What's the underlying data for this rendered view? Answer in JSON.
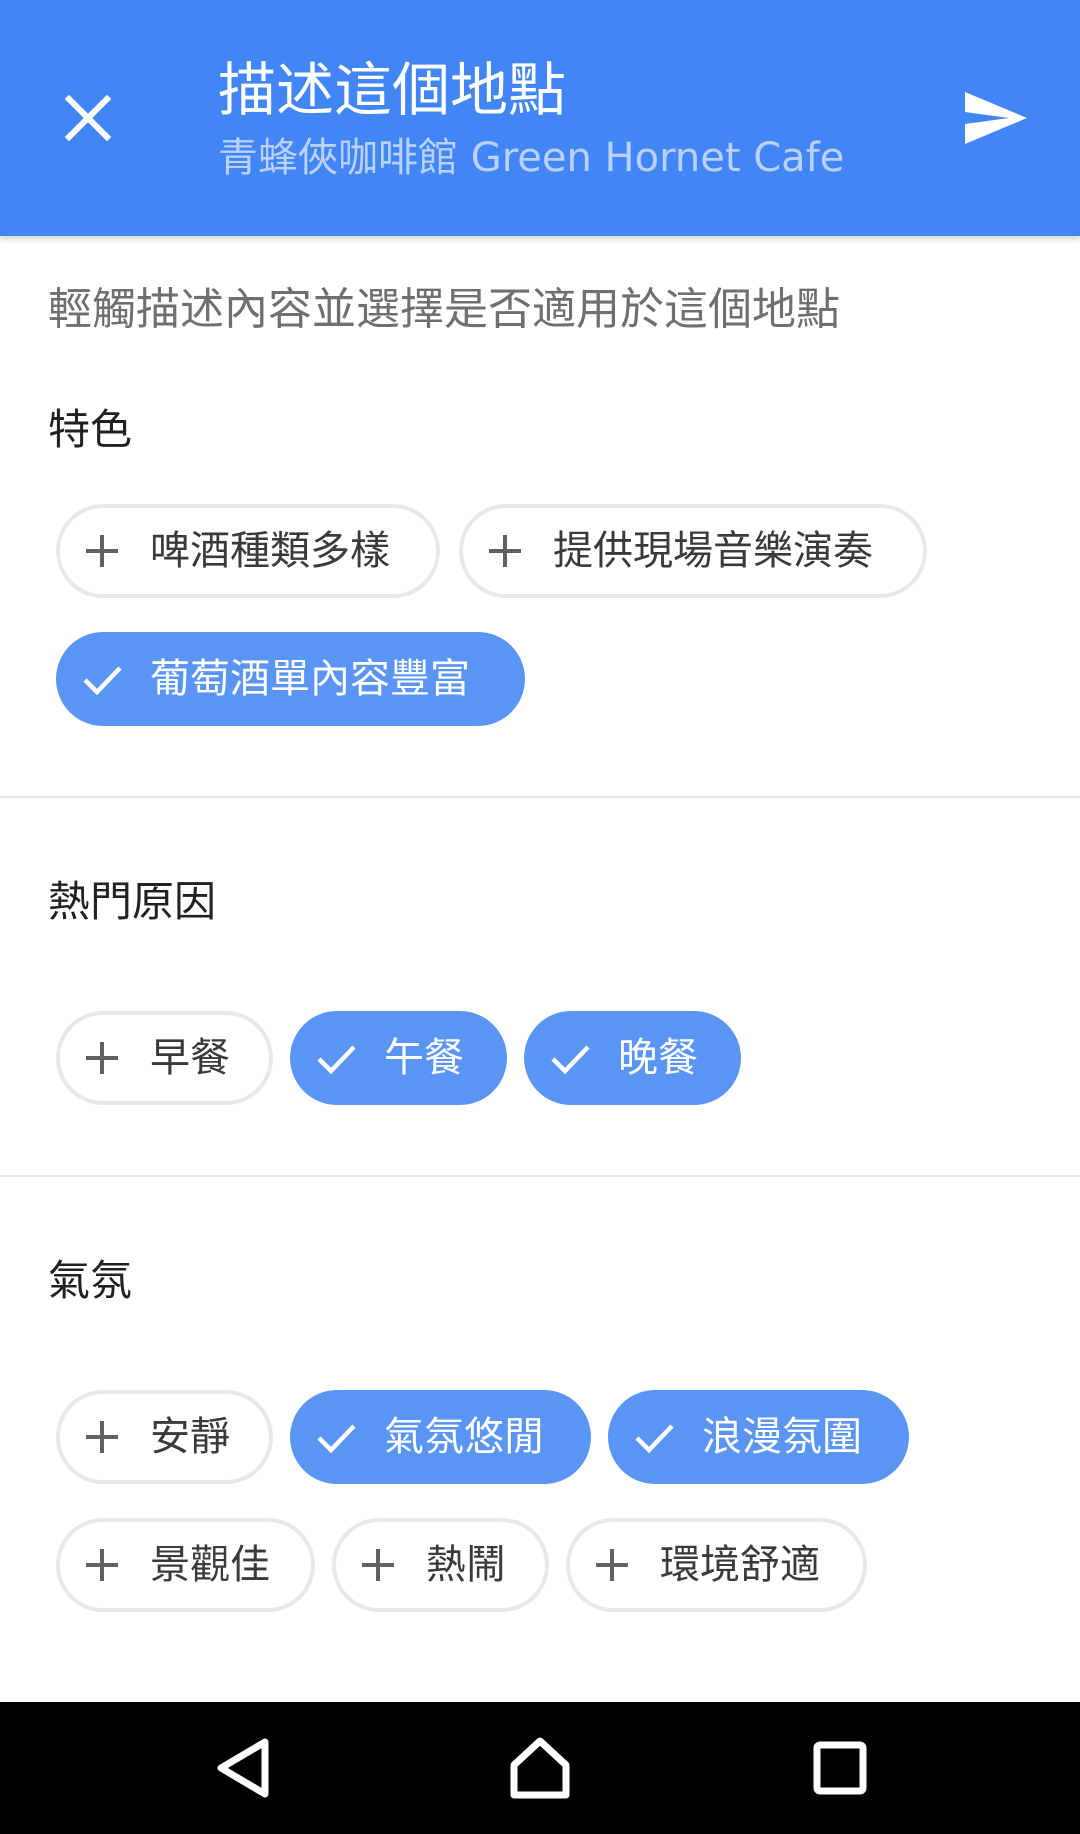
{
  "header": {
    "title": "描述這個地點",
    "subtitle": "青蜂俠咖啡館 Green Hornet Cafe",
    "close_icon": "close-icon",
    "send_icon": "send-icon",
    "background_color": "#4285f4"
  },
  "instruction": "輕觸描述內容並選擇是否適用於這個地點",
  "sections": [
    {
      "title": "特色",
      "chips": [
        {
          "label": "啤酒種類多樣",
          "selected": false
        },
        {
          "label": "提供現場音樂演奏",
          "selected": false
        },
        {
          "label": "葡萄酒單內容豐富",
          "selected": true
        }
      ]
    },
    {
      "title": "熱門原因",
      "chips": [
        {
          "label": "早餐",
          "selected": false
        },
        {
          "label": "午餐",
          "selected": true
        },
        {
          "label": "晚餐",
          "selected": true
        }
      ]
    },
    {
      "title": "氣氛",
      "chips": [
        {
          "label": "安靜",
          "selected": false
        },
        {
          "label": "氣氛悠閒",
          "selected": true
        },
        {
          "label": "浪漫氛圍",
          "selected": true
        },
        {
          "label": "景觀佳",
          "selected": false
        },
        {
          "label": "熱鬧",
          "selected": false
        },
        {
          "label": "環境舒適",
          "selected": false
        }
      ]
    }
  ],
  "icons": {
    "unselected_chip": "plus-icon",
    "selected_chip": "check-icon"
  },
  "colors": {
    "selected_chip": "#5b95f3",
    "unselected_chip_border": "#e8e8e8"
  },
  "navigation_bar": {
    "back_icon": "back-triangle-icon",
    "home_icon": "home-icon",
    "recents_icon": "recents-square-icon"
  }
}
